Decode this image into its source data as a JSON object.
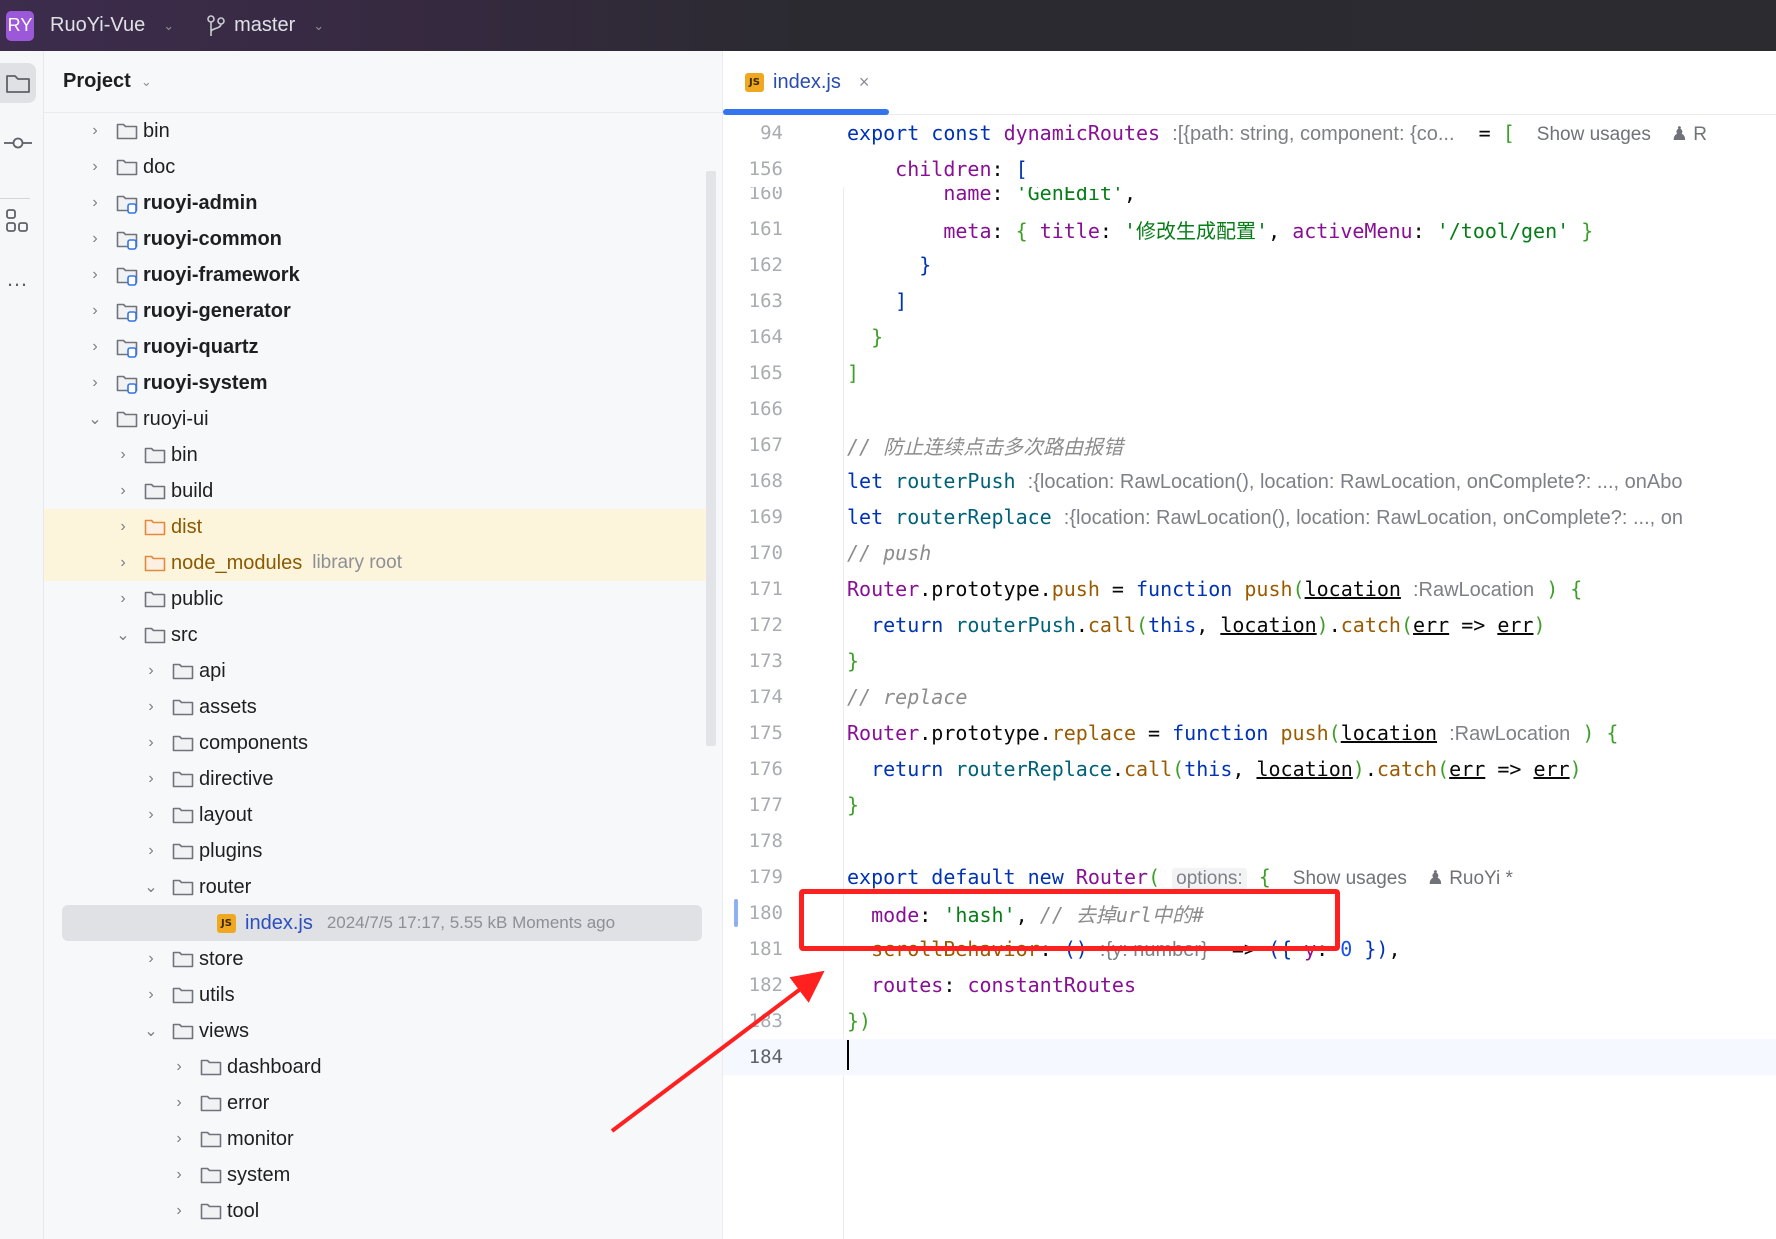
{
  "titlebar": {
    "project_badge": "RY",
    "project_name": "RuoYi-Vue",
    "branch": "master"
  },
  "toolstrip": {
    "items": [
      "project-icon",
      "commit-icon",
      "structure-icon",
      "more-icon"
    ]
  },
  "project_panel": {
    "title": "Project",
    "tree": [
      {
        "name": "bin",
        "depth": 0,
        "expanded": false,
        "type": "folder"
      },
      {
        "name": "doc",
        "depth": 0,
        "expanded": false,
        "type": "folder"
      },
      {
        "name": "ruoyi-admin",
        "depth": 0,
        "expanded": false,
        "type": "module"
      },
      {
        "name": "ruoyi-common",
        "depth": 0,
        "expanded": false,
        "type": "module"
      },
      {
        "name": "ruoyi-framework",
        "depth": 0,
        "expanded": false,
        "type": "module"
      },
      {
        "name": "ruoyi-generator",
        "depth": 0,
        "expanded": false,
        "type": "module"
      },
      {
        "name": "ruoyi-quartz",
        "depth": 0,
        "expanded": false,
        "type": "module"
      },
      {
        "name": "ruoyi-system",
        "depth": 0,
        "expanded": false,
        "type": "module"
      },
      {
        "name": "ruoyi-ui",
        "depth": 0,
        "expanded": true,
        "type": "folder"
      },
      {
        "name": "bin",
        "depth": 1,
        "expanded": false,
        "type": "folder"
      },
      {
        "name": "build",
        "depth": 1,
        "expanded": false,
        "type": "folder"
      },
      {
        "name": "dist",
        "depth": 1,
        "expanded": false,
        "type": "excluded"
      },
      {
        "name": "node_modules",
        "depth": 1,
        "expanded": false,
        "type": "excluded",
        "hint": "library root"
      },
      {
        "name": "public",
        "depth": 1,
        "expanded": false,
        "type": "folder"
      },
      {
        "name": "src",
        "depth": 1,
        "expanded": true,
        "type": "folder"
      },
      {
        "name": "api",
        "depth": 2,
        "expanded": false,
        "type": "folder"
      },
      {
        "name": "assets",
        "depth": 2,
        "expanded": false,
        "type": "folder"
      },
      {
        "name": "components",
        "depth": 2,
        "expanded": false,
        "type": "folder"
      },
      {
        "name": "directive",
        "depth": 2,
        "expanded": false,
        "type": "folder"
      },
      {
        "name": "layout",
        "depth": 2,
        "expanded": false,
        "type": "folder"
      },
      {
        "name": "plugins",
        "depth": 2,
        "expanded": false,
        "type": "folder"
      },
      {
        "name": "router",
        "depth": 2,
        "expanded": true,
        "type": "folder"
      },
      {
        "name": "index.js",
        "depth": 3,
        "type": "js-file",
        "selected": true,
        "meta": "2024/7/5 17:17, 5.55 kB Moments ago"
      },
      {
        "name": "store",
        "depth": 2,
        "expanded": false,
        "type": "folder"
      },
      {
        "name": "utils",
        "depth": 2,
        "expanded": false,
        "type": "folder"
      },
      {
        "name": "views",
        "depth": 2,
        "expanded": true,
        "type": "folder"
      },
      {
        "name": "dashboard",
        "depth": 3,
        "expanded": false,
        "type": "folder"
      },
      {
        "name": "error",
        "depth": 3,
        "expanded": false,
        "type": "folder"
      },
      {
        "name": "monitor",
        "depth": 3,
        "expanded": false,
        "type": "folder"
      },
      {
        "name": "system",
        "depth": 3,
        "expanded": false,
        "type": "folder"
      },
      {
        "name": "tool",
        "depth": 3,
        "expanded": false,
        "type": "folder"
      }
    ]
  },
  "editor": {
    "tab": {
      "badge": "JS",
      "label": "index.js",
      "close": "×"
    },
    "sticky": {
      "l94": {
        "num": "94",
        "kw1": "export",
        "kw2": "const",
        "name": "dynamicRoutes",
        "hint": ":[{path: string, component: {co...",
        "eq": "=",
        "bracket": "[",
        "usages": "Show usages",
        "author": "R"
      },
      "l156": {
        "num": "156",
        "prop": "children",
        "colon": ":",
        "bracket": "["
      }
    },
    "lines": {
      "l160": {
        "num": "160",
        "prop": "name",
        "str": "'GenEdit'"
      },
      "l161": {
        "num": "161",
        "prop": "meta",
        "key": "title",
        "str": "'修改生成配置'",
        "key2": "activeMenu",
        "str2": "'/tool/gen'"
      },
      "l162": {
        "num": "162",
        "text": "}"
      },
      "l163": {
        "num": "163",
        "text": "]"
      },
      "l164": {
        "num": "164",
        "text": "}"
      },
      "l165": {
        "num": "165",
        "text": "]"
      },
      "l166": {
        "num": "166"
      },
      "l167": {
        "num": "167",
        "comment": "// 防止连续点击多次路由报错"
      },
      "l168": {
        "num": "168",
        "kw": "let",
        "name": "routerPush",
        "hint": ":{location: RawLocation(), location: RawLocation, onComplete?: ..., onAbo"
      },
      "l169": {
        "num": "169",
        "kw": "let",
        "name": "routerReplace",
        "hint": ":{location: RawLocation(), location: RawLocation, onComplete?: ..., on"
      },
      "l170": {
        "num": "170",
        "comment": "// push"
      },
      "l171": {
        "num": "171",
        "obj": "Router",
        "proto": ".prototype.",
        "method": "push",
        "eq": " = ",
        "kw": "function",
        "fname": "push",
        "param": "location",
        "hint": ":RawLocation"
      },
      "l172": {
        "num": "172",
        "kw": "return",
        "name": "routerPush",
        "call": "call",
        "this": "this",
        "param": "location",
        "catch": "catch",
        "err": "err",
        "arrow": "=>"
      },
      "l173": {
        "num": "173",
        "text": "}"
      },
      "l174": {
        "num": "174",
        "comment": "// replace"
      },
      "l175": {
        "num": "175",
        "obj": "Router",
        "proto": ".prototype.",
        "method": "replace",
        "eq": " = ",
        "kw": "function",
        "fname": "push",
        "param": "location",
        "hint": ":RawLocation"
      },
      "l176": {
        "num": "176",
        "kw": "return",
        "name": "routerReplace",
        "call": "call",
        "this": "this",
        "param": "location",
        "catch": "catch",
        "err": "err",
        "arrow": "=>"
      },
      "l177": {
        "num": "177",
        "text": "}"
      },
      "l178": {
        "num": "178"
      },
      "l179": {
        "num": "179",
        "kw1": "export",
        "kw2": "default",
        "kw3": "new",
        "cls": "Router",
        "hint": "options:",
        "usages": "Show usages",
        "author": "RuoYi *"
      },
      "l180": {
        "num": "180",
        "prop": "mode",
        "str": "'hash'",
        "comment": "// 去掉url中的#"
      },
      "l181": {
        "num": "181",
        "prop": "scrollBehavior",
        "hint": ":{y: number}",
        "key": "y",
        "val": "0"
      },
      "l182": {
        "num": "182",
        "prop": "routes",
        "value": "constantRoutes"
      },
      "l183": {
        "num": "183",
        "text": "})"
      },
      "l184": {
        "num": "184"
      }
    }
  },
  "annotation": {
    "color": "#ff2020",
    "note": "red box highlighting mode: 'hash' line with arrow"
  },
  "colors": {
    "accent": "#3574f0",
    "project_badge": "#9b59d9",
    "excluded_row": "#fdf4dc",
    "annotation": "#ff2020"
  }
}
